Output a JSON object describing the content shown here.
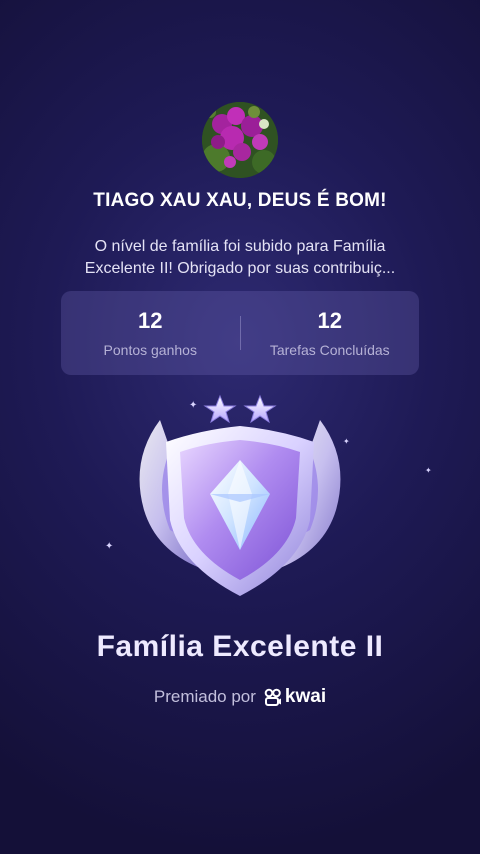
{
  "profile": {
    "avatar_icon": "flower-photo-avatar",
    "family_name": "TIAGO XAU XAU, DEUS É BOM!"
  },
  "message": {
    "line1": "O nível de família foi subido para Família",
    "line2": "Excelente II! Obrigado por suas contribuiç..."
  },
  "stats": {
    "points_value": "12",
    "points_label": "Pontos ganhos",
    "tasks_value": "12",
    "tasks_label": "Tarefas Concluídas"
  },
  "badge": {
    "icon": "diamond-shield-badge-icon",
    "stars": 2,
    "level_name": "Família Excelente II"
  },
  "award": {
    "prefix": "Premiado por",
    "brand": "kwai"
  },
  "colors": {
    "background": "#1e1a55",
    "card": "#3a3575",
    "accent": "#b9a8ff"
  }
}
